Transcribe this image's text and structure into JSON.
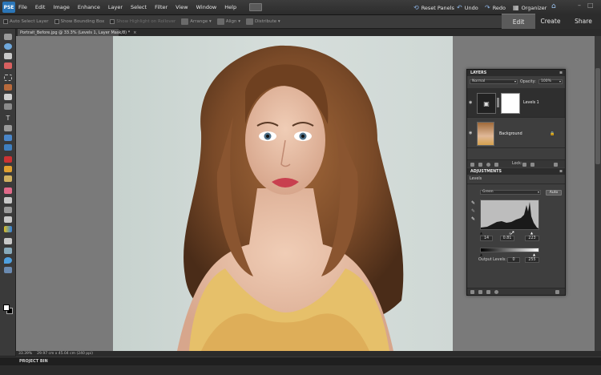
{
  "app": {
    "logo_text": "PSE"
  },
  "menu": [
    "File",
    "Edit",
    "Image",
    "Enhance",
    "Layer",
    "Select",
    "Filter",
    "View",
    "Window",
    "Help"
  ],
  "topbar": {
    "reset_panels": "Reset Panels",
    "undo": "Undo",
    "redo": "Redo",
    "organizer": "Organizer"
  },
  "mode_tabs": {
    "edit": "Edit",
    "create": "Create",
    "share": "Share",
    "active": "Edit"
  },
  "options": {
    "auto_select": "Auto Select Layer",
    "show_bounding": "Show Bounding Box",
    "show_highlight": "Show Highlight on Rollover",
    "arrange": "Arrange",
    "align": "Align",
    "distribute": "Distribute"
  },
  "document": {
    "tab_title": "Portrait_Before.jpg @ 33.3% (Levels 1, Layer Mask/8) *",
    "close": "×"
  },
  "status": {
    "zoom": "33.39%",
    "dimensions": "29.97 cm x 45.04 cm (240 ppi)"
  },
  "project_bin": "PROJECT BIN",
  "layers_panel": {
    "title": "LAYERS",
    "blend_mode": "Normal",
    "opacity_label": "Opacity:",
    "opacity_value": "100%",
    "layers": [
      {
        "name": "Levels 1",
        "type": "adjustment"
      },
      {
        "name": "Background",
        "type": "image",
        "locked": true
      }
    ],
    "lock_label": "Lock:"
  },
  "adjustments_panel": {
    "title": "ADJUSTMENTS",
    "subtitle": "Levels",
    "channel": "Green",
    "auto_button": "Auto",
    "input_black": "14",
    "input_gamma": "0.81",
    "input_white": "223",
    "output_label": "Output Levels:",
    "output_black": "0",
    "output_white": "255"
  },
  "colors": {
    "accent": "#2b76b8",
    "canvas_bg": "#7a7a7a",
    "panel_bg": "#3e3e3e"
  }
}
